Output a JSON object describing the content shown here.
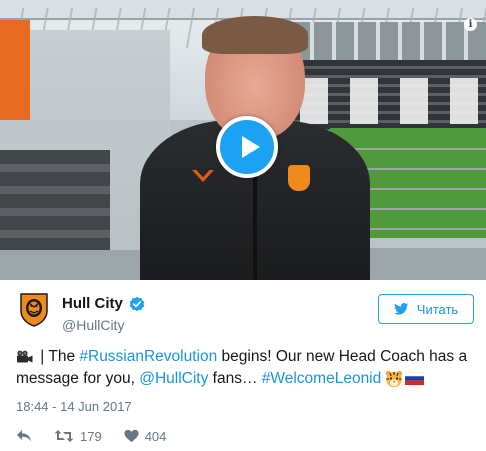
{
  "video": {
    "play_icon": "play-icon",
    "info_glyph": "i",
    "info_icon": "info-icon"
  },
  "account": {
    "display_name": "Hull City",
    "handle": "@HullCity",
    "verified_icon": "verified-badge-icon",
    "avatar_icon": "hull-city-crest"
  },
  "follow_button": {
    "label": "Читать",
    "icon": "twitter-bird-icon"
  },
  "tweet": {
    "prefix_separator": " | The ",
    "hashtag_revolution": "#RussianRevolution",
    "middle_text": " begins! Our new Head Coach has a message for you, ",
    "mention": "@HullCity",
    "after_mention": " fans… ",
    "hashtag_leonid": "#WelcomeLeonid",
    "emojis": [
      "movie-camera-icon",
      "tiger-face-icon",
      "russia-flag-icon"
    ]
  },
  "timestamp": "18:44 - 14 Jun 2017",
  "actions": {
    "reply_icon": "reply-icon",
    "retweet_icon": "retweet-icon",
    "retweet_count": "179",
    "like_icon": "heart-icon",
    "like_count": "404"
  },
  "colors": {
    "link": "#1b95e0",
    "twitter_blue": "#1da1f2",
    "secondary_text": "#657786",
    "club_orange": "#f08a1c"
  }
}
